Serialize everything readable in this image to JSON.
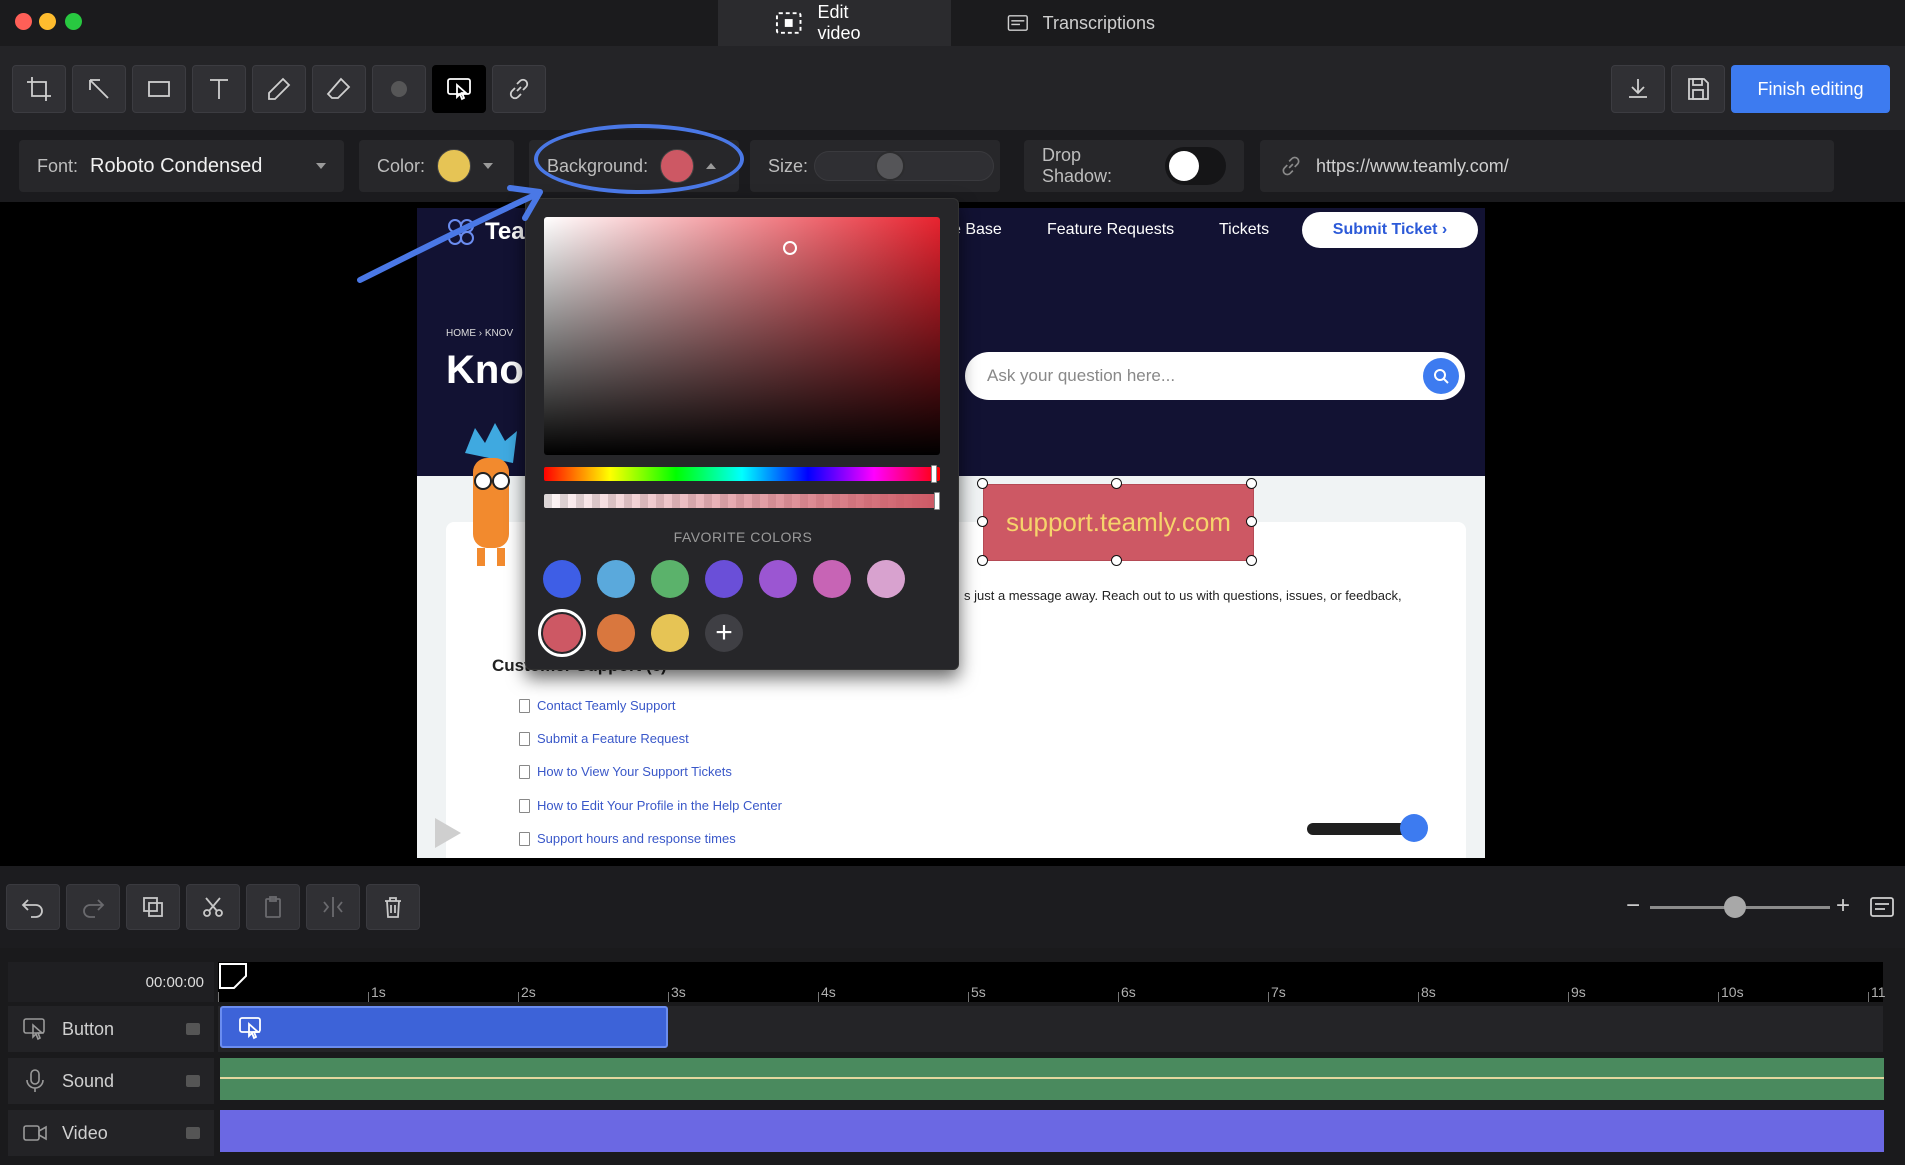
{
  "window": {
    "tabs": [
      {
        "label": "Edit video",
        "icon": "edit-video-icon",
        "active": true
      },
      {
        "label": "Transcriptions",
        "icon": "transcript-icon",
        "active": false
      }
    ]
  },
  "toolbar": {
    "tools": [
      "crop-icon",
      "arrow-icon",
      "rectangle-icon",
      "text-icon",
      "pen-icon",
      "eraser-icon",
      "blur-icon",
      "button-icon",
      "link-icon"
    ],
    "selected_tool": "button-icon",
    "finish_label": "Finish editing"
  },
  "properties": {
    "font_label": "Font:",
    "font_value": "Roboto Condensed",
    "color_label": "Color:",
    "color_value": "#e6c455",
    "background_label": "Background:",
    "background_value": "#cd5864",
    "size_label": "Size:",
    "shadow_label": "Drop Shadow:",
    "url_value": "https://www.teamly.com/"
  },
  "color_picker": {
    "favorites_title": "FAVORITE COLORS",
    "favorites_row1": [
      "#3e5ee6",
      "#5aa9dc",
      "#5bb26b",
      "#6a4fd8",
      "#9b56d2",
      "#c764b5",
      "#d8a2cf"
    ],
    "favorites_row2": [
      "#cd5864",
      "#d9773e",
      "#e6c455"
    ],
    "selected": "#cd5864"
  },
  "preview": {
    "brand": "Tea",
    "nav": [
      "e Base",
      "Feature Requests",
      "Tickets"
    ],
    "submit": "Submit Ticket ›",
    "breadcrumb": "HOME  ›  KNOV",
    "heading": "Kno",
    "search_placeholder": "Ask your question here...",
    "overlay_text": "support.teamly.com",
    "body_text": "s just a message away. Reach out to us with questions, issues, or feedback,",
    "section_title": "Customer Support (6)",
    "links": [
      "Contact Teamly Support",
      "Submit a Feature Request",
      "How to View Your Support Tickets",
      "How to Edit Your Profile in the Help Center",
      "Support hours and response times"
    ]
  },
  "timeline": {
    "current_time": "00:00:00",
    "ticks": [
      "1s",
      "2s",
      "3s",
      "4s",
      "5s",
      "6s",
      "7s",
      "8s",
      "9s",
      "10s",
      "11"
    ],
    "tracks": [
      {
        "label": "Button",
        "icon": "button-icon"
      },
      {
        "label": "Sound",
        "icon": "microphone-icon"
      },
      {
        "label": "Video",
        "icon": "video-camera-icon"
      }
    ]
  }
}
